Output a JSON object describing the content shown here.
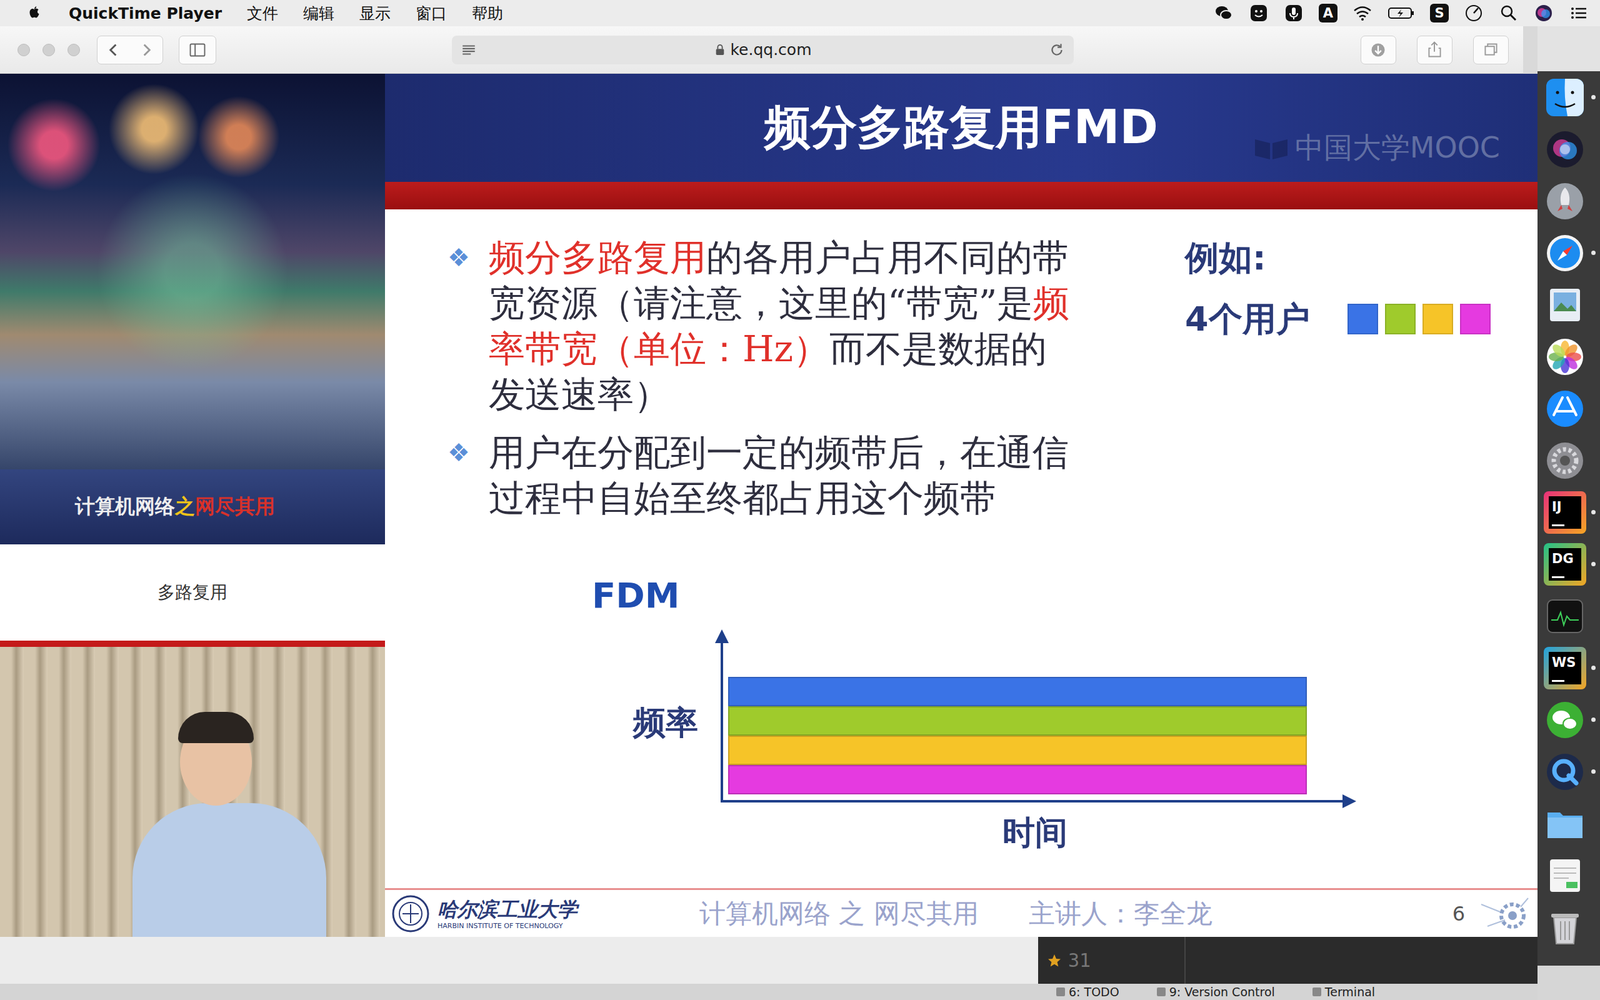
{
  "menubar": {
    "app": "QuickTime Player",
    "menus": [
      "文件",
      "编辑",
      "显示",
      "窗口",
      "帮助"
    ],
    "status": [
      {
        "kind": "wechat"
      },
      {
        "kind": "face"
      },
      {
        "kind": "mic"
      },
      {
        "kind": "text",
        "label": "A"
      },
      {
        "kind": "wifi"
      },
      {
        "kind": "battery"
      },
      {
        "kind": "text",
        "label": "S"
      },
      {
        "kind": "gauge"
      },
      {
        "kind": "search"
      },
      {
        "kind": "siri"
      },
      {
        "kind": "list"
      }
    ]
  },
  "browser": {
    "url": "ke.qq.com"
  },
  "slide": {
    "title": "频分多路复用FMD",
    "watermark": "中国大学MOOC",
    "banner": [
      {
        "text": "计算机网络",
        "color": "#eeeeee"
      },
      {
        "text": "之",
        "color": "#f0c419"
      },
      {
        "text": "网尽其用",
        "color": "#d8312a"
      }
    ],
    "section": "多路复用",
    "bullet_mark": "❖",
    "bullets": [
      [
        {
          "text": "频分多路复用",
          "highlight": true
        },
        {
          "text": "的各用户占用不同的带宽资源（请注意，这里的“带宽”是",
          "highlight": false
        },
        {
          "text": "频率带宽（单位：Hz）",
          "highlight": true
        },
        {
          "text": "而不是数据的发送速率）",
          "highlight": false
        }
      ],
      [
        {
          "text": "用户在分配到一定的频带后，在通信过程中自始至终都占用这个频带",
          "highlight": false
        }
      ]
    ],
    "example": {
      "label": "例如:",
      "users_label": "4个用户"
    },
    "users": [
      {
        "color": "#3a73e6"
      },
      {
        "color": "#9fcb2c"
      },
      {
        "color": "#f6c428"
      },
      {
        "color": "#e53ae0"
      }
    ],
    "chart": {
      "title": "FDM",
      "y_label": "频率",
      "x_label": "时间"
    },
    "footer": {
      "school": "哈尔滨工业大学",
      "school_en": "HARBIN INSTITUTE OF TECHNOLOGY",
      "course": "计算机网络 之 网尽其用",
      "lecturer": "主讲人：李全龙",
      "page": "6"
    }
  },
  "ide": {
    "line": "31",
    "tabs": [
      "6: TODO",
      "9: Version Control",
      "Terminal"
    ]
  },
  "dock": [
    {
      "kind": "finder",
      "running": true
    },
    {
      "kind": "siri",
      "running": false
    },
    {
      "kind": "launchpad",
      "running": false
    },
    {
      "kind": "safari",
      "running": true
    },
    {
      "kind": "preview",
      "running": false
    },
    {
      "kind": "photos",
      "running": false
    },
    {
      "kind": "appstore",
      "running": false
    },
    {
      "kind": "prefs",
      "running": false
    },
    {
      "kind": "label",
      "label": "IJ",
      "color": "#e8307a",
      "running": true
    },
    {
      "kind": "label",
      "label": "DG",
      "color": "#21c288",
      "running": true
    },
    {
      "kind": "monitor",
      "running": false
    },
    {
      "kind": "label",
      "label": "WS",
      "color": "#1fa3e0",
      "running": true
    },
    {
      "kind": "wechat",
      "running": true
    },
    {
      "kind": "quicktime",
      "running": true
    },
    {
      "kind": "folder",
      "running": false
    },
    {
      "kind": "notes",
      "running": false
    },
    {
      "kind": "trash",
      "running": false
    }
  ]
}
